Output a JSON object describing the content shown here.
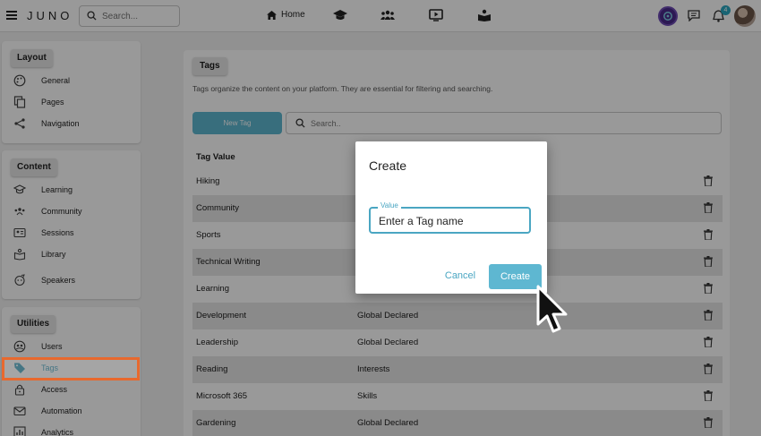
{
  "topbar": {
    "logo": "JUNO",
    "search_placeholder": "Search...",
    "home_label": "Home",
    "notification_count": "4",
    "icons": [
      "menu-icon",
      "search-icon",
      "home-icon",
      "graduation-cap-icon",
      "community-icon",
      "play-icon",
      "library-icon",
      "settings-icon",
      "chat-icon",
      "bell-icon",
      "avatar"
    ]
  },
  "sidebar": {
    "layout": {
      "title": "Layout",
      "items": [
        {
          "label": "General",
          "icon": "palette-icon"
        },
        {
          "label": "Pages",
          "icon": "pages-icon"
        },
        {
          "label": "Navigation",
          "icon": "share-icon"
        }
      ]
    },
    "content": {
      "title": "Content",
      "items": [
        {
          "label": "Learning",
          "icon": "graduation-cap-icon"
        },
        {
          "label": "Community",
          "icon": "community-icon"
        },
        {
          "label": "Sessions",
          "icon": "sessions-icon"
        },
        {
          "label": "Library",
          "icon": "library-icon"
        },
        {
          "label": "Speakers",
          "icon": "speaker-icon"
        }
      ]
    },
    "utilities": {
      "title": "Utilities",
      "items": [
        {
          "label": "Users",
          "icon": "users-icon"
        },
        {
          "label": "Tags",
          "icon": "tag-icon",
          "active": true
        },
        {
          "label": "Access",
          "icon": "lock-icon"
        },
        {
          "label": "Automation",
          "icon": "mail-icon"
        },
        {
          "label": "Analytics",
          "icon": "analytics-icon"
        }
      ]
    }
  },
  "main": {
    "title": "Tags",
    "description": "Tags organize the content on your platform. They are essential for filtering and searching.",
    "new_tag_label": "New Tag",
    "search_placeholder": "Search..",
    "column_header": "Tag Value",
    "rows": [
      {
        "value": "Hiking",
        "type": ""
      },
      {
        "value": "Community",
        "type": ""
      },
      {
        "value": "Sports",
        "type": ""
      },
      {
        "value": "Technical Writing",
        "type": ""
      },
      {
        "value": "Learning",
        "type": ""
      },
      {
        "value": "Development",
        "type": "Global Declared"
      },
      {
        "value": "Leadership",
        "type": "Global Declared"
      },
      {
        "value": "Reading",
        "type": "Interests"
      },
      {
        "value": "Microsoft 365",
        "type": "Skills"
      },
      {
        "value": "Gardening",
        "type": "Global Declared"
      }
    ]
  },
  "dialog": {
    "title": "Create",
    "field_label": "Value",
    "field_value": "Enter a Tag name",
    "cancel_label": "Cancel",
    "create_label": "Create"
  },
  "colors": {
    "accent": "#5eb7d1",
    "highlight": "#e8692e",
    "active_text": "#4aa6c2"
  }
}
